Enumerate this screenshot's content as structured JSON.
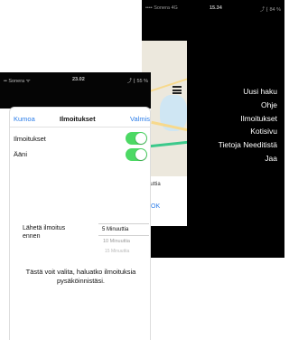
{
  "back_screen": {
    "status": {
      "carrier": "•••• Sonera  4G",
      "time": "15.34",
      "battery": "⤴ ⁅ 84 %"
    },
    "map_panel": {
      "tab_text": "uuttia",
      "ok_label": "OK"
    },
    "menu": {
      "items": [
        {
          "label": "Uusi haku"
        },
        {
          "label": "Ohje"
        },
        {
          "label": "Ilmoitukset"
        },
        {
          "label": "Kotisivu"
        },
        {
          "label": "Tietoja Needitistä"
        },
        {
          "label": "Jaa"
        }
      ]
    }
  },
  "front_screen": {
    "status": {
      "carrier": "•• Sonera  ᯤ",
      "time": "23.02",
      "battery": "⤴ ⁅ 55 %"
    },
    "nav": {
      "cancel_label": "Kumoa",
      "title": "Ilmoitukset",
      "done_label": "Valmis"
    },
    "settings": {
      "notifications_label": "Ilmoitukset",
      "notifications_on": true,
      "sound_label": "Ääni",
      "sound_on": true
    },
    "send_before": {
      "label": "Lähetä ilmoitus ennen",
      "selected": "5 Minuuttia",
      "options": [
        "10 Minuuttia",
        "15 Minuuttia"
      ]
    },
    "info_text": "Tästä voit valita, haluatko ilmoituksia pysäköinnistäsi."
  },
  "colors": {
    "accent": "#2b7de9",
    "toggle_on": "#4cd964",
    "menu_background": "#000000"
  }
}
